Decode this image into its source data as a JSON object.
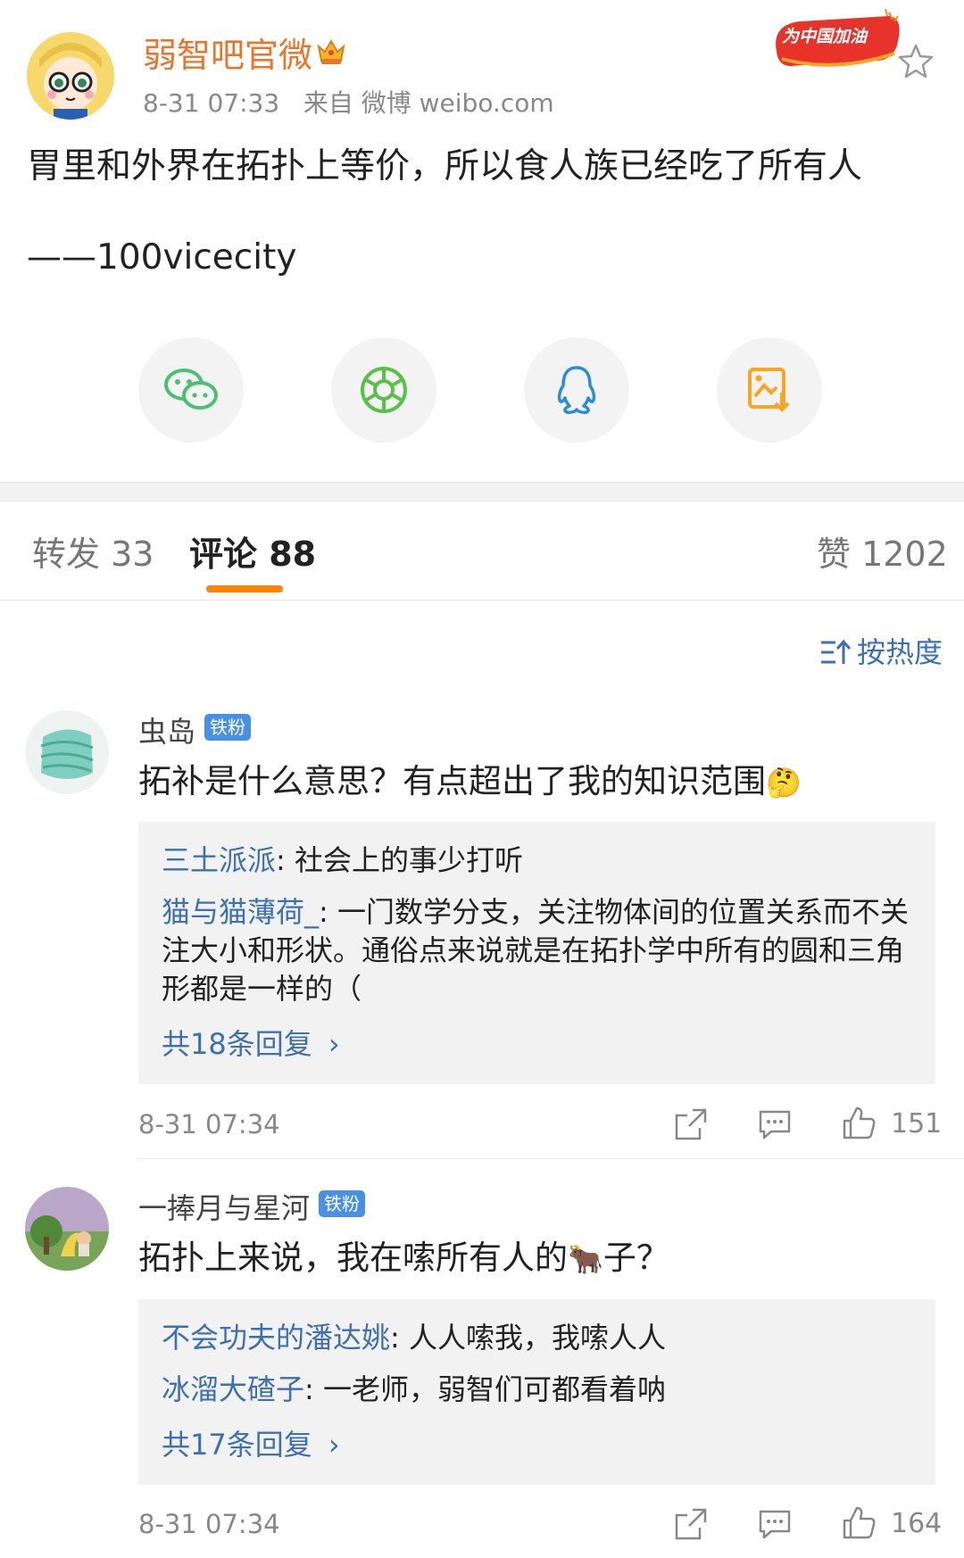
{
  "post": {
    "author": "弱智吧官微",
    "time": "8-31 07:33",
    "source": "来自 微博 weibo.com",
    "badge_text": "为中国加油",
    "text": "胃里和外界在拓扑上等价，所以食人族已经吃了所有人",
    "signature": "——100vicecity"
  },
  "share": {
    "icons": [
      "wechat-icon",
      "moments-icon",
      "qq-icon",
      "save-image-icon"
    ]
  },
  "tabs": {
    "repost": "转发 33",
    "comment": "评论 88",
    "like": "赞 1202"
  },
  "sort_label": "按热度",
  "comments": [
    {
      "user": "虫岛",
      "badge": "铁粉",
      "text": "拓补是什么意思？有点超出了我的知识范围",
      "emoji": "🤔",
      "replies": [
        {
          "user": "三土派派",
          "text": ": 社会上的事少打听"
        },
        {
          "user": "猫与猫薄荷_",
          "text": ": 一门数学分支，关注物体间的位置关系而不关注大小和形状。通俗点来说就是在拓扑学中所有的圆和三角形都是一样的（"
        }
      ],
      "more": "共18条回复",
      "time": "8-31 07:34",
      "likes": "151"
    },
    {
      "user": "一捧月与星河",
      "badge": "铁粉",
      "text_before": "拓扑上来说，我在嗦所有人的",
      "emoji": "🐂",
      "text_after": "子？",
      "replies": [
        {
          "user": "不会功夫的潘达姚",
          "text": ": 人人嗦我，我嗦人人"
        },
        {
          "user": "冰溜大碴子",
          "text": ": 一老师，弱智们可都看着呐"
        }
      ],
      "more": "共17条回复",
      "time": "8-31 07:34",
      "likes": "164"
    }
  ],
  "colors": {
    "accent_orange": "#ff8200",
    "link_blue": "#3d6fb5",
    "author_orange": "#e8752c"
  }
}
